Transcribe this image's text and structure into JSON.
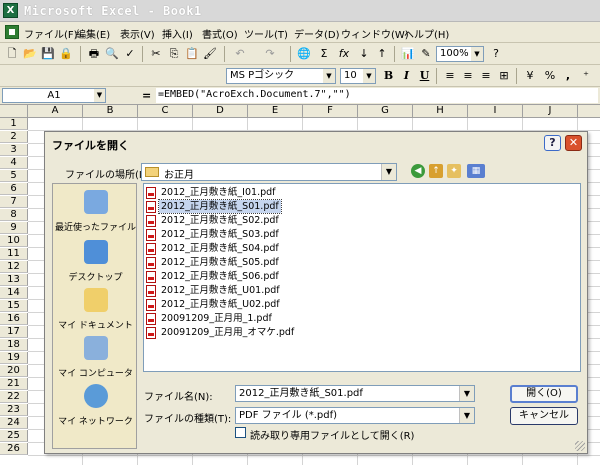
{
  "window": {
    "title": "Microsoft Excel - Book1"
  },
  "menu": [
    "ファイル(F)",
    "編集(E)",
    "表示(V)",
    "挿入(I)",
    "書式(O)",
    "ツール(T)",
    "データ(D)",
    "ウィンドウ(W)",
    "ヘルプ(H)"
  ],
  "toolbar": {
    "zoom": "100%"
  },
  "format_bar": {
    "font": "MS Pゴシック",
    "size": "10"
  },
  "formula_bar": {
    "cell": "A1",
    "eq": "=",
    "formula": "=EMBED(\"AcroExch.Document.7\",\"\")"
  },
  "sheet": {
    "columns": [
      "A",
      "B",
      "C",
      "D",
      "E",
      "F",
      "G",
      "H",
      "I",
      "J"
    ],
    "rows": [
      "1",
      "2",
      "3",
      "4",
      "5",
      "6",
      "7",
      "8",
      "9",
      "10",
      "11",
      "12",
      "13",
      "14",
      "15",
      "16",
      "17",
      "18",
      "19",
      "20",
      "21",
      "22",
      "23",
      "24",
      "25",
      "26"
    ]
  },
  "dialog": {
    "title": "ファイルを開く",
    "help": "?",
    "close": "✕",
    "look_in_label": "ファイルの場所(I):",
    "look_in_value": "お正月",
    "places": [
      "最近使ったファイル",
      "デスクトップ",
      "マイ ドキュメント",
      "マイ コンピュータ",
      "マイ ネットワーク"
    ],
    "files": [
      "2012_正月敷き紙_I01.pdf",
      "2012_正月敷き紙_S01.pdf",
      "2012_正月敷き紙_S02.pdf",
      "2012_正月敷き紙_S03.pdf",
      "2012_正月敷き紙_S04.pdf",
      "2012_正月敷き紙_S05.pdf",
      "2012_正月敷き紙_S06.pdf",
      "2012_正月敷き紙_U01.pdf",
      "2012_正月敷き紙_U02.pdf",
      "20091209_正月用_1.pdf",
      "20091209_正月用_オマケ.pdf"
    ],
    "selected_file": "2012_正月敷き紙_S01.pdf",
    "filename_label": "ファイル名(N):",
    "filename_value": "2012_正月敷き紙_S01.pdf",
    "filetype_label": "ファイルの種類(T):",
    "filetype_value": "PDF ファイル (*.pdf)",
    "readonly_label": "読み取り専用ファイルとして開く(R)",
    "open_button": "開く(O)",
    "cancel_button": "キャンセル"
  }
}
